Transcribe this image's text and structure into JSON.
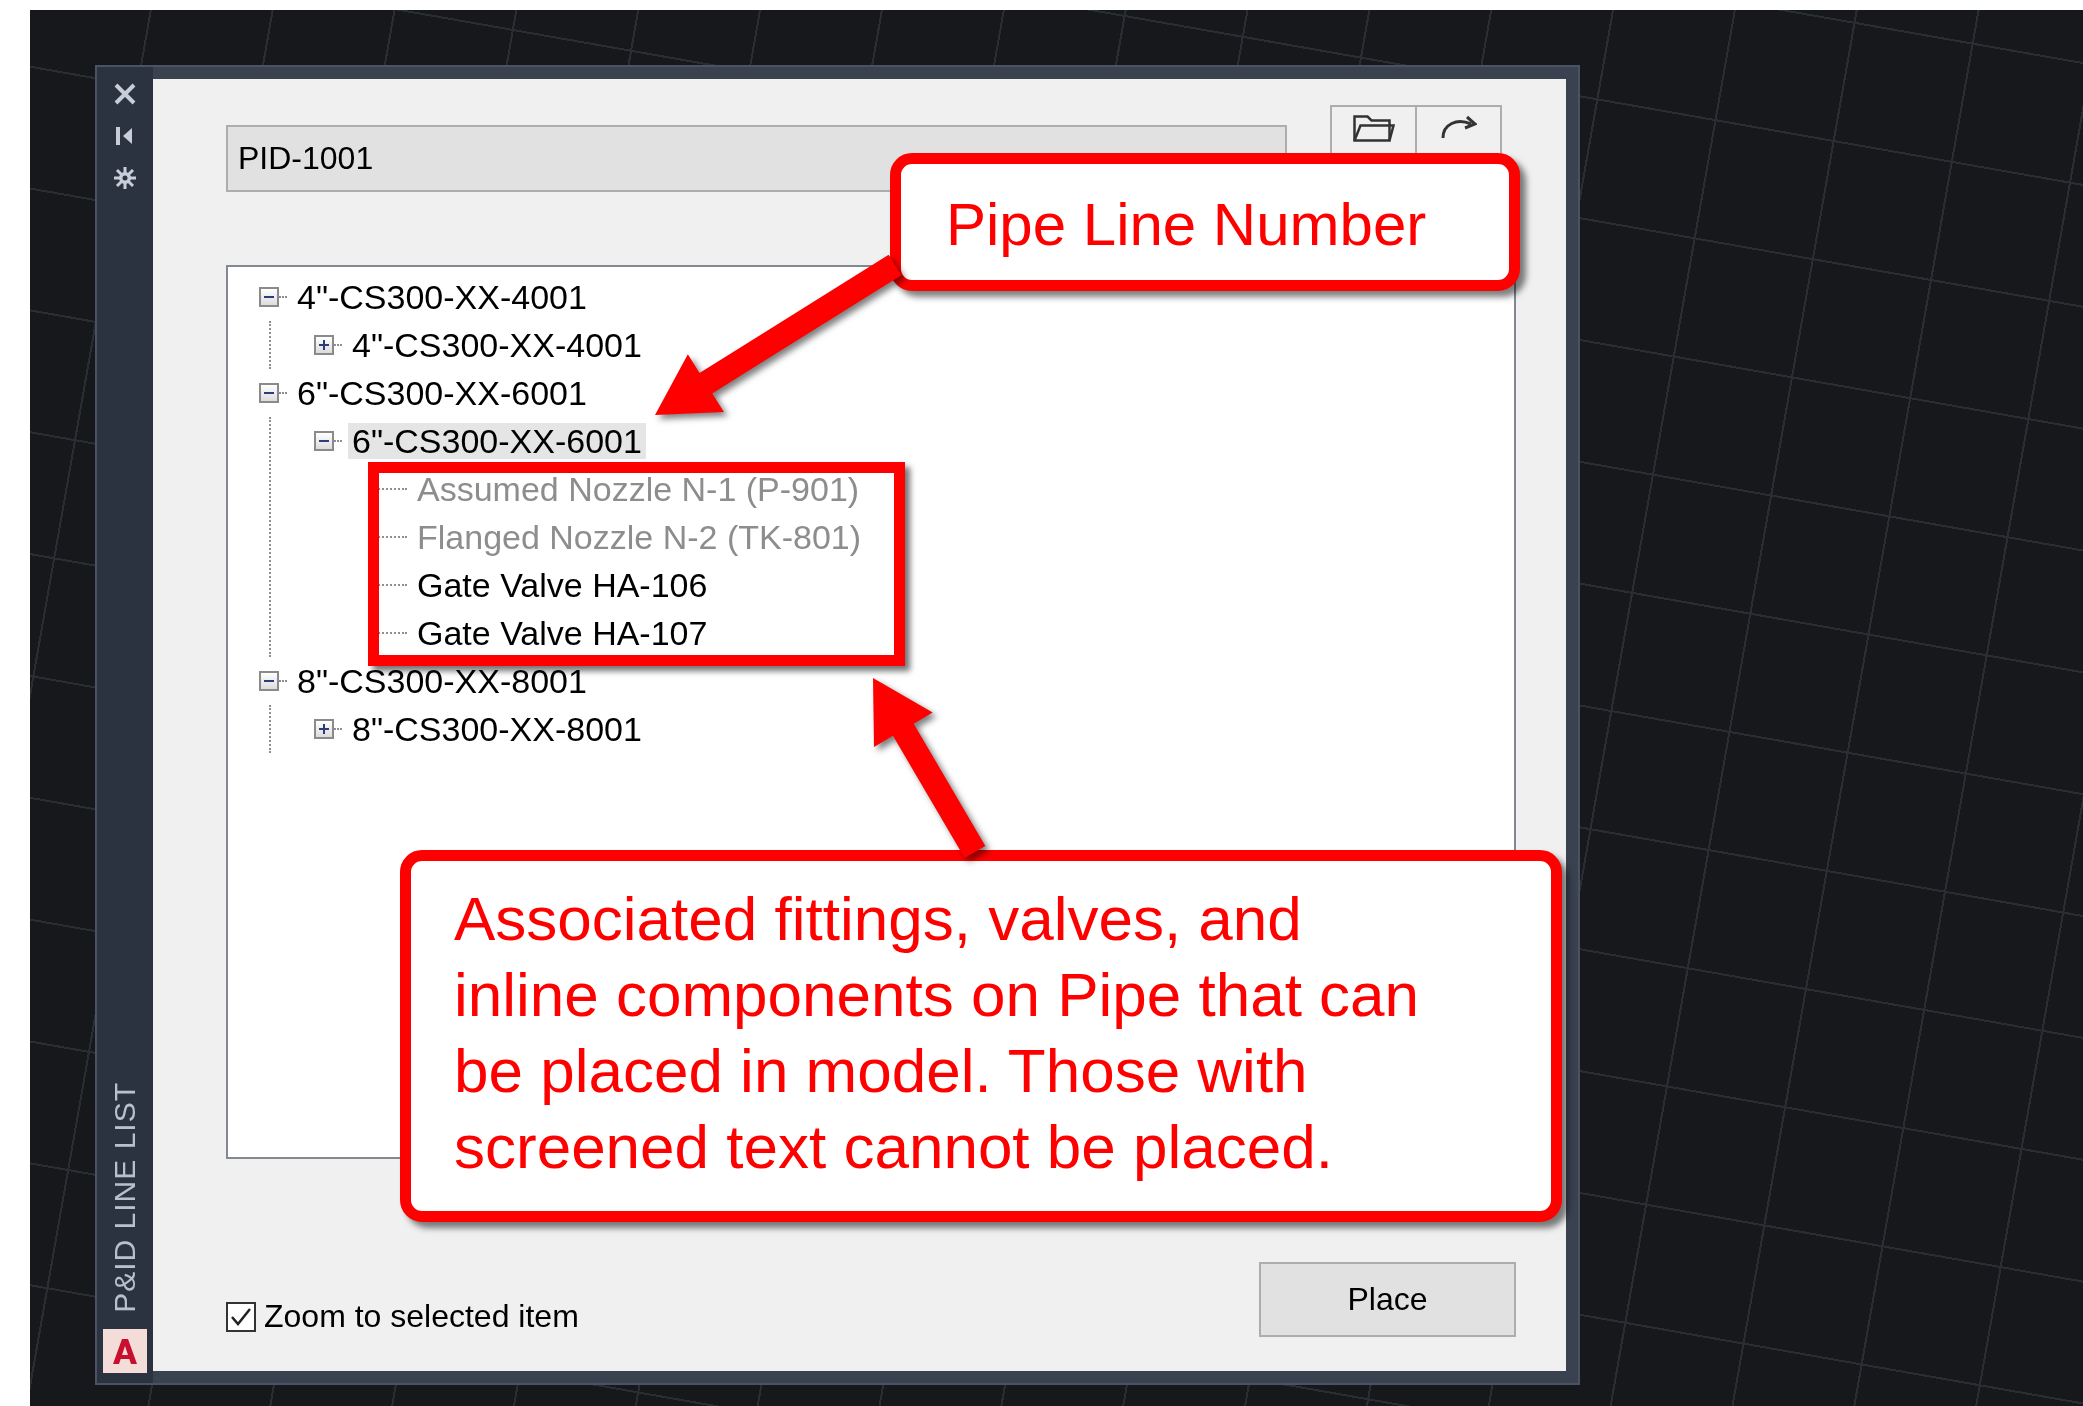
{
  "palette": {
    "title": "P&ID LINE LIST"
  },
  "drawing_selector": {
    "value": "PID-1001"
  },
  "tree": [
    {
      "label": "4\"-CS300-XX-4001",
      "expanded": true,
      "selected": false,
      "children": [
        {
          "label": "4\"-CS300-XX-4001",
          "expanded": false,
          "selected": false
        }
      ]
    },
    {
      "label": "6\"-CS300-XX-6001",
      "expanded": true,
      "selected": false,
      "children": [
        {
          "label": "6\"-CS300-XX-6001",
          "expanded": true,
          "selected": true,
          "children": [
            {
              "label": "Assumed Nozzle N-1 (P-901)",
              "disabled": true,
              "selected": false
            },
            {
              "label": "Flanged Nozzle N-2 (TK-801)",
              "disabled": true,
              "selected": false
            },
            {
              "label": "Gate Valve HA-106",
              "disabled": false,
              "selected": false
            },
            {
              "label": "Gate Valve HA-107",
              "disabled": false,
              "selected": false
            }
          ]
        }
      ]
    },
    {
      "label": "8\"-CS300-XX-8001",
      "expanded": true,
      "selected": false,
      "children": [
        {
          "label": "8\"-CS300-XX-8001",
          "expanded": false,
          "selected": false
        }
      ]
    }
  ],
  "zoom_option": {
    "label": "Zoom to selected item",
    "checked": true
  },
  "place_button": {
    "label": "Place"
  },
  "annotations": [
    {
      "kind": "callout",
      "text": "Pipe Line Number"
    },
    {
      "kind": "highlight"
    },
    {
      "kind": "callout",
      "text": "Associated fittings, valves, and inline components on Pipe that can be placed in model. Those with screened text cannot be placed."
    }
  ]
}
